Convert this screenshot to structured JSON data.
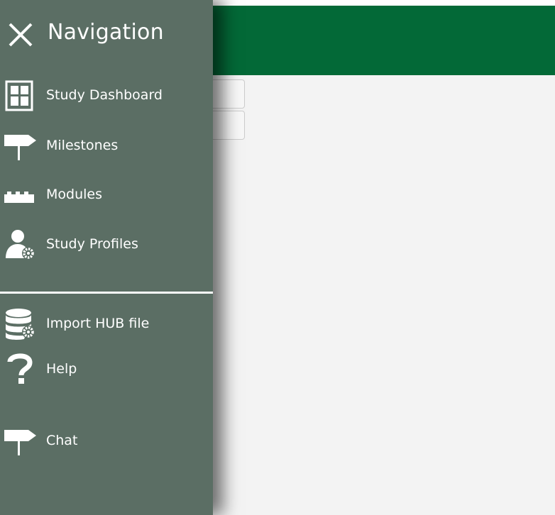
{
  "navigation": {
    "title": "Navigation",
    "close_icon": "close-icon",
    "items": [
      {
        "label": "Study Dashboard",
        "icon": "dashboard-grid-icon"
      },
      {
        "label": "Milestones",
        "icon": "signpost-icon"
      },
      {
        "label": "Modules",
        "icon": "brick-icon"
      },
      {
        "label": "Study Profiles",
        "icon": "user-settings-icon"
      }
    ],
    "secondary_items": [
      {
        "label": "Import HUB file",
        "icon": "database-settings-icon"
      },
      {
        "label": "Help",
        "icon": "question-mark-icon"
      },
      {
        "label": "Chat",
        "icon": "signpost-icon"
      }
    ]
  },
  "colors": {
    "header_green": "#036937",
    "nav_background": "#5b6e64",
    "content_background": "#f3f3f3"
  }
}
